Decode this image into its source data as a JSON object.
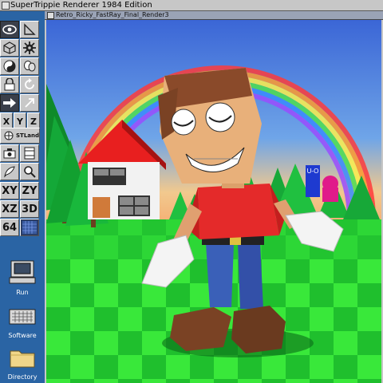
{
  "app": {
    "title": "SuperTrippie Renderer 1984 Edition"
  },
  "window": {
    "title": "Retro_Ricky_FastRay_Final_Render3"
  },
  "toolbox": {
    "xy_z": [
      "X",
      "Y",
      "Z"
    ],
    "stland_label": "STLand",
    "plane_labels": [
      "XY",
      "ZY",
      "XZ",
      "3D"
    ],
    "bits_label": "64"
  },
  "desktop": {
    "run_label": "Run",
    "software_label": "Software",
    "directory_label": "Directory"
  },
  "scene": {
    "sign_text": "U-O"
  },
  "colors": {
    "sidebar": "#2a64a4",
    "sky_top": "#3b66d6",
    "grass_light": "#39e83a",
    "grass_dark": "#0f9a1f"
  }
}
